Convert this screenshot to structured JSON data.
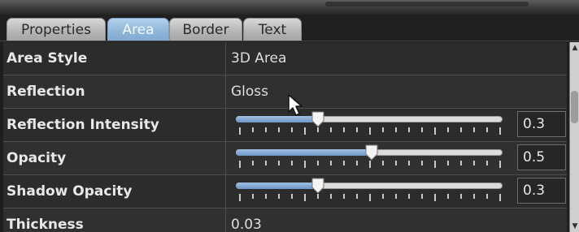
{
  "tabs": [
    {
      "label": "Properties",
      "active": false
    },
    {
      "label": "Area",
      "active": true
    },
    {
      "label": "Border",
      "active": false
    },
    {
      "label": "Text",
      "active": false
    }
  ],
  "properties": {
    "area_style": {
      "label": "Area Style",
      "value": "3D Area"
    },
    "reflection": {
      "label": "Reflection",
      "value": "Gloss"
    },
    "reflection_intensity": {
      "label": "Reflection Intensity",
      "value": "0.3",
      "level": 0.3
    },
    "opacity": {
      "label": "Opacity",
      "value": "0.5",
      "level": 0.5
    },
    "shadow_opacity": {
      "label": "Shadow Opacity",
      "value": "0.3",
      "level": 0.3
    },
    "thickness": {
      "label": "Thickness",
      "value": "0.03"
    }
  },
  "slider_scale": {
    "min": 0,
    "max": 1,
    "tick_count": 21
  },
  "icons": {
    "cursor": "mouse-pointer-icon",
    "scroll_up": "scroll-up-arrow-icon",
    "scroll_down": "scroll-down-arrow-icon"
  },
  "colors": {
    "accent": "#8fb5d8",
    "panel": "#2c2c2c",
    "text": "#e8e8e8"
  }
}
